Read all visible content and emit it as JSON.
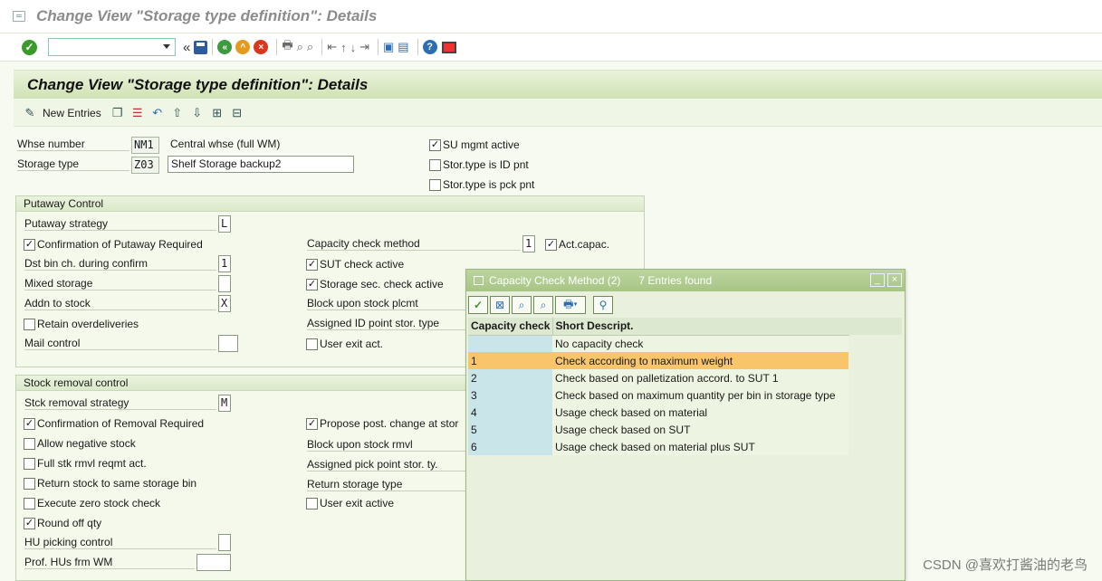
{
  "window": {
    "title": "Change View \"Storage type definition\": Details"
  },
  "content": {
    "title": "Change View \"Storage type definition\": Details"
  },
  "apptoolbar": {
    "new_entries": "New Entries"
  },
  "header_fields": {
    "whse_label": "Whse number",
    "whse_value": "NM1",
    "whse_desc": "Central whse (full WM)",
    "stype_label": "Storage type",
    "stype_value": "Z03",
    "stype_desc": "Shelf Storage backup2",
    "su_mgmt": "SU mgmt active",
    "id_pnt": "Stor.type is ID pnt",
    "pck_pnt": "Stor.type is pck pnt"
  },
  "putaway": {
    "title": "Putaway Control",
    "strategy_label": "Putaway strategy",
    "strategy_value": "L",
    "confirm": "Confirmation of Putaway Required",
    "dst_bin_label": "Dst bin ch. during confirm",
    "dst_bin_value": "1",
    "mixed_label": "Mixed storage",
    "mixed_value": "",
    "addn_label": "Addn to stock",
    "addn_value": "X",
    "retain": "Retain overdeliveries",
    "mail_label": "Mail control",
    "mail_value": "",
    "cap_method_label": "Capacity check method",
    "cap_method_value": "1",
    "act_capac": "Act.capac.",
    "sut_check": "SUT check active",
    "sec_check": "Storage sec. check active",
    "block_label": "Block upon stock plcmt",
    "assigned_id_label": "Assigned ID point stor. type",
    "user_exit": "User exit act."
  },
  "removal": {
    "title": "Stock removal control",
    "strategy_label": "Stck removal strategy",
    "strategy_value": "M",
    "confirm": "Confirmation of Removal Required",
    "allow_neg": "Allow negative stock",
    "full_stk": "Full stk rmvl reqmt act.",
    "return_same": "Return stock to same storage bin",
    "zero_check": "Execute zero stock check",
    "round_off": "Round off qty",
    "hu_label": "HU picking control",
    "hu_value": "",
    "prof_label": "Prof. HUs frm WM",
    "prof_value": "",
    "propose": "Propose post. change at stor",
    "block_label": "Block upon stock rmvl",
    "pick_point_label": "Assigned pick point stor. ty.",
    "return_type_label": "Return storage type",
    "user_exit": "User exit active"
  },
  "popup": {
    "title": "Capacity Check Method (2)",
    "found": "7 Entries found",
    "columns": [
      "Capacity check",
      "Short Descript."
    ],
    "rows": [
      {
        "key": "",
        "desc": "No capacity check"
      },
      {
        "key": "1",
        "desc": "Check according to maximum weight"
      },
      {
        "key": "2",
        "desc": "Check based on palletization accord. to SUT 1"
      },
      {
        "key": "3",
        "desc": "Check based on maximum quantity per bin in storage type"
      },
      {
        "key": "4",
        "desc": "Usage check based on material"
      },
      {
        "key": "5",
        "desc": "Usage check based on SUT"
      },
      {
        "key": "6",
        "desc": "Usage check based on material plus SUT"
      }
    ],
    "selected_index": 1
  },
  "watermark": "CSDN @喜欢打酱油的老鸟",
  "icons": [
    "window-icon",
    "enter-icon",
    "save-icon",
    "back-icon",
    "exit-icon",
    "cancel-icon",
    "print-icon",
    "find-icon",
    "find-next-icon",
    "first-page-icon",
    "prev-page-icon",
    "next-page-icon",
    "last-page-icon",
    "new-session-icon",
    "shortcut-icon",
    "help-icon",
    "layout-icon"
  ]
}
